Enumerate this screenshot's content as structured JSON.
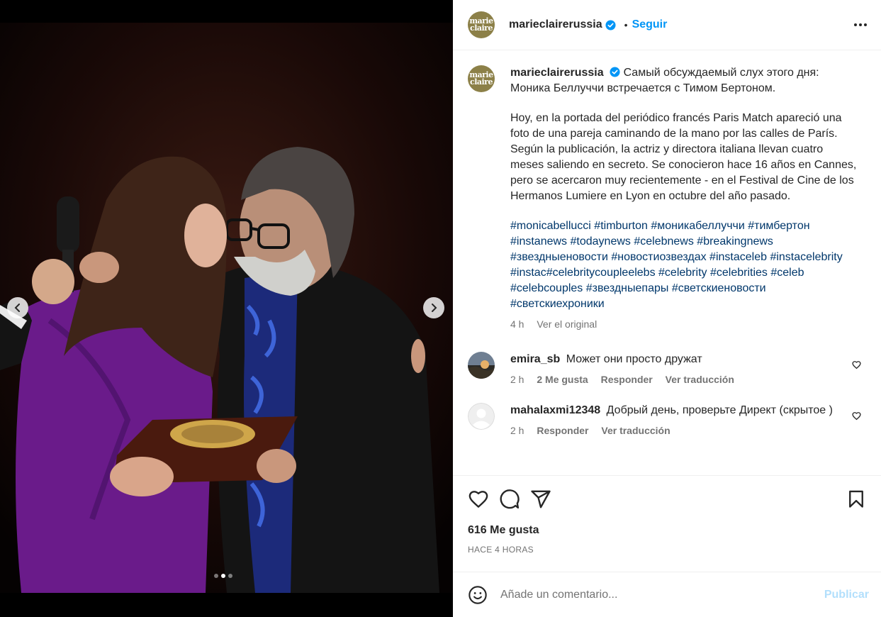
{
  "post": {
    "account": {
      "username": "marieclairerussia",
      "avatar_text_line1": "marie",
      "avatar_text_line2": "claire",
      "verified": true,
      "follow_separator": "•",
      "follow_label": "Seguir"
    },
    "media": {
      "slide_count": 3,
      "active_slide": 2,
      "description_icons": [
        "chevron-left-icon",
        "chevron-right-icon"
      ]
    },
    "caption": {
      "line1": "Самый обсуждаемый слух этого дня: Моника Беллуччи встречается с Тимом Бертоном.",
      "paragraph2": "Hoy, en la portada del periódico francés Paris Match apareció una foto de una pareja caminando de la mano por las calles de París. Según la publicación, la actriz y directora italiana llevan cuatro meses saliendo en secreto. Se conocieron hace 16 años en Cannes, pero se acercaron muy recientemente - en el Festival de Cine de los Hermanos Lumiere en Lyon en octubre del año pasado.",
      "hashtags": [
        "#monicabellucci",
        "#timburton",
        "#моникабеллуччи",
        "#тимбертон",
        "#instanews",
        "#todaynews",
        "#celebnews",
        "#breakingnews",
        "#звездныеновости",
        "#новостиозвездах",
        "#instaceleb",
        "#instacelebrity",
        "#instac#celebritycoupleelebs",
        "#celebrity",
        "#celebrities",
        "#celeb",
        "#celebcouples",
        "#звездныепары",
        "#светскиеновости",
        "#светскиехроники"
      ],
      "time": "4 h",
      "see_original": "Ver el original"
    },
    "comments": [
      {
        "username": "emira_sb",
        "text": "Может они просто дружат",
        "time": "2 h",
        "likes": "2 Me gusta",
        "reply": "Responder",
        "translate": "Ver traducción"
      },
      {
        "username": "mahalaxmi12348",
        "text": "Добрый день, проверьте Директ (скрытое )",
        "time": "2 h",
        "reply": "Responder",
        "translate": "Ver traducción"
      }
    ],
    "actions": {
      "icons": [
        "heart-icon",
        "comment-icon",
        "share-icon",
        "bookmark-icon"
      ],
      "likes": "616 Me gusta",
      "time_ago": "HACE 4 HORAS"
    },
    "composer": {
      "placeholder": "Añade un comentario...",
      "publish_label": "Publicar"
    }
  },
  "colors": {
    "brand_avatar": "#8c8048",
    "link_blue": "#0095f6",
    "hashtag": "#00376b",
    "muted": "#737373",
    "publish_disabled": "#b2dffc"
  }
}
